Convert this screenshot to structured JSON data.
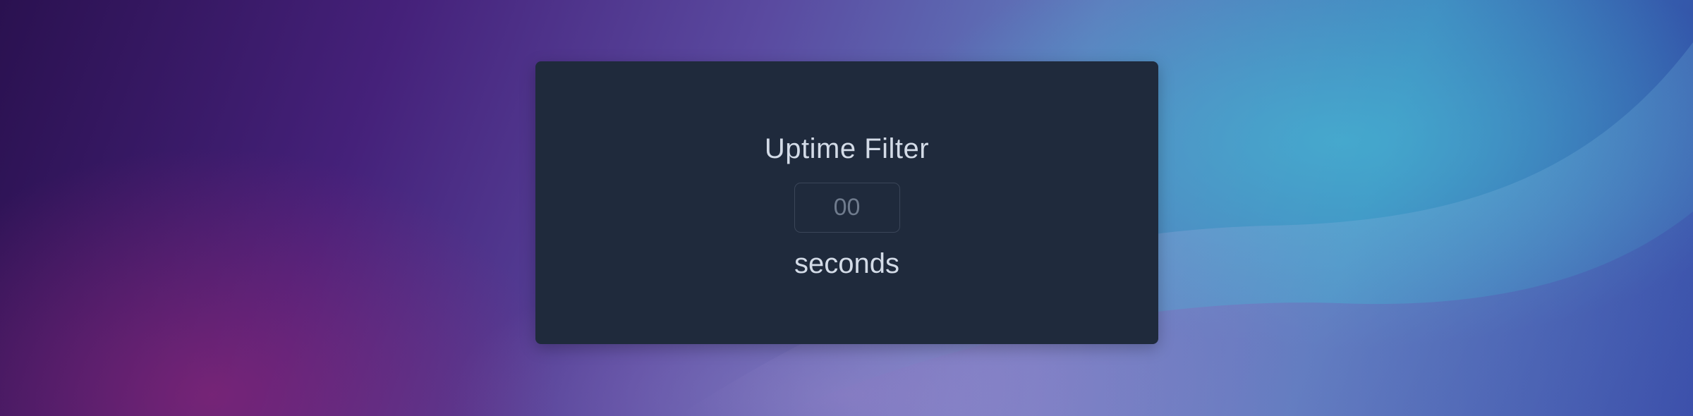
{
  "uptime_filter": {
    "title": "Uptime Filter",
    "input_placeholder": "00",
    "input_value": "",
    "unit_label": "seconds"
  },
  "colors": {
    "panel_background": "#1f2a3c",
    "text_primary": "#d3dbe7",
    "input_border": "#3b4659",
    "input_placeholder": "#6f7b8d"
  }
}
